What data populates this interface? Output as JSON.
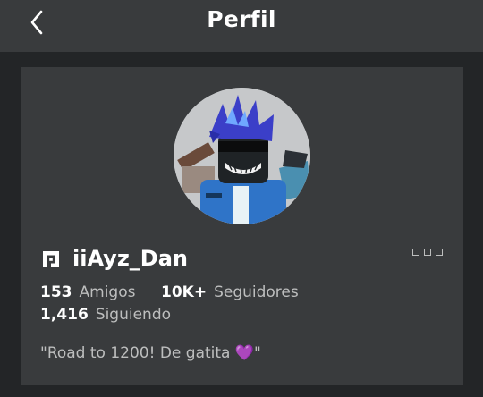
{
  "header": {
    "title": "Perfil"
  },
  "profile": {
    "username": "iiAyz_Dan",
    "stats": [
      {
        "value": "153",
        "label": "Amigos"
      },
      {
        "value": "10K+",
        "label": "Seguidores"
      },
      {
        "value": "1,416",
        "label": "Siguiendo"
      }
    ],
    "bio_text": "\"Road to 1200! De gatita ",
    "bio_emoji": "💜",
    "bio_end": "\""
  },
  "icons": {
    "back": "chevron-left-icon",
    "premium": "premium-icon",
    "more": "more-options-icon"
  },
  "colors": {
    "background": "#232527",
    "panel": "#393b3d",
    "secondary_text": "#bdbebe"
  }
}
